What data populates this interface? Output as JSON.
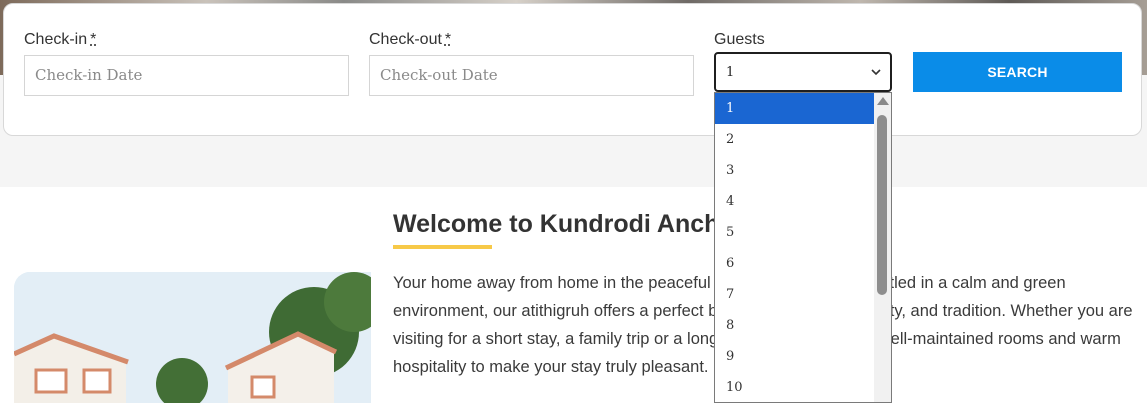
{
  "booking": {
    "checkin": {
      "label": "Check-in",
      "required": "*",
      "placeholder": "Check-in Date"
    },
    "checkout": {
      "label": "Check-out",
      "required": "*",
      "placeholder": "Check-out Date"
    },
    "guests": {
      "label": "Guests",
      "selected": "1",
      "options": [
        "1",
        "2",
        "3",
        "4",
        "5",
        "6",
        "7",
        "8",
        "9",
        "10"
      ]
    },
    "search_label": "SEARCH"
  },
  "welcome": {
    "title": "Welcome to Kundrodi Anchal Atithigruh",
    "paragraph": "Your home away from home in the peaceful village of Kundrodi. Nestled in a calm and green environment, our atithigruh offers a perfect blend of comfort, simplicity, and tradition. Whether you are visiting for a short stay, a family trip or a longer retreat, we provide well-maintained rooms and warm hospitality to make your stay truly pleasant."
  },
  "colors": {
    "accent": "#0a8ce8",
    "underline": "#f7c948",
    "selected_option": "#1a66d2"
  },
  "icons": {
    "guests_select": "chevron-down-icon",
    "scroll_up": "scroll-up-icon"
  }
}
